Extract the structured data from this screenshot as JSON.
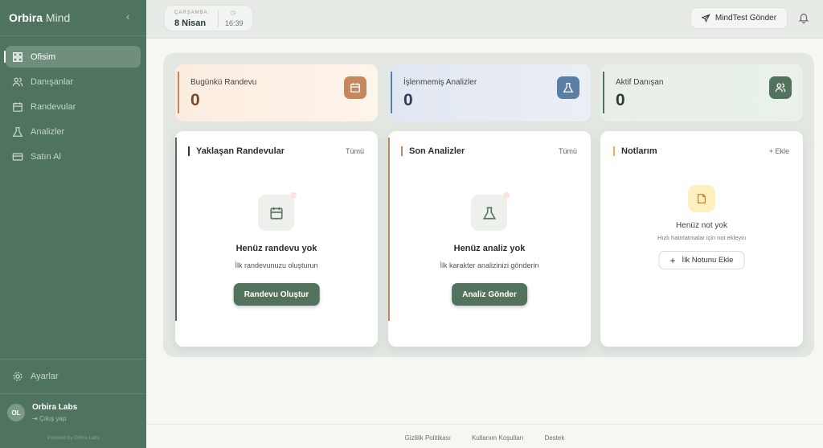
{
  "sidebar": {
    "brand_bold": "Orbira",
    "brand_light": "Mind",
    "items": [
      {
        "label": "Ofisim"
      },
      {
        "label": "Danışanlar"
      },
      {
        "label": "Randevular"
      },
      {
        "label": "Analizler"
      },
      {
        "label": "Satın Al"
      }
    ],
    "settings": "Ayarlar",
    "user": {
      "initials": "OL",
      "name": "Orbira Labs",
      "logout": "Çıkış yap"
    },
    "powered": "Powered by Orbira Labs"
  },
  "topbar": {
    "day": "ÇARŞAMBA",
    "date": "8 Nisan",
    "time": "16:39",
    "send": "MindTest Gönder"
  },
  "stats": [
    {
      "title": "Bugünkü Randevu",
      "value": "0",
      "color": "#c4885c"
    },
    {
      "title": "İşlenmemiş Analizler",
      "value": "0",
      "color": "#5b7ea4"
    },
    {
      "title": "Aktif Danışan",
      "value": "0",
      "color": "#52725e"
    }
  ],
  "cards": [
    {
      "title": "Yaklaşan Randevular",
      "link": "Tümü",
      "empty_title": "Henüz randevu yok",
      "empty_sub": "İlk randevunuzu oluşturun",
      "button": "Randevu Oluştur"
    },
    {
      "title": "Son Analizler",
      "link": "Tümü",
      "empty_title": "Henüz analiz yok",
      "empty_sub": "İlk karakter analizinizi gönderin",
      "button": "Analiz Gönder"
    },
    {
      "title": "Notlarım",
      "link": "+ Ekle",
      "empty_title": "Henüz not yok",
      "empty_sub": "Hızlı hatırlatmalar için not ekleyin",
      "button": "İlk Notunu Ekle"
    }
  ],
  "footer": [
    "Gizlilik Politikası",
    "Kullanım Koşulları",
    "Destek"
  ]
}
